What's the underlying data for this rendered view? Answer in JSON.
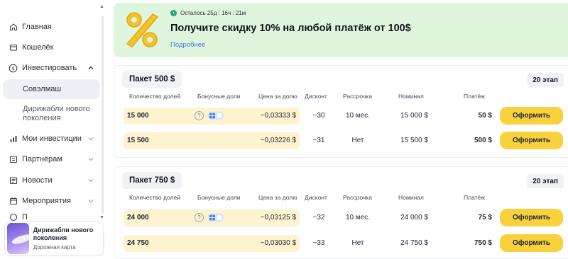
{
  "sidebar": {
    "items": [
      {
        "label": "Главная",
        "icon": "home-icon"
      },
      {
        "label": "Кошелёк",
        "icon": "wallet-icon"
      },
      {
        "label": "Инвестировать",
        "icon": "coin-icon",
        "expanded": true
      },
      {
        "label": "Мои инвестиции",
        "icon": "chart-icon"
      },
      {
        "label": "Партнёрам",
        "icon": "partners-icon"
      },
      {
        "label": "Новости",
        "icon": "news-icon"
      },
      {
        "label": "Мероприятия",
        "icon": "calendar-icon"
      },
      {
        "label": "П",
        "icon": "partial-icon"
      }
    ],
    "subitems": {
      "active": "Совэлмаш",
      "other": "Дирижабли нового поколения"
    },
    "promo": {
      "title": "Дирижабли нового поколения",
      "subtitle": "Дорожная карта"
    }
  },
  "banner": {
    "timer": "Осталось 25д : 16ч : 21м",
    "title": "Получите скидку 10% на любой платёж от 100$",
    "link": "Подробнее",
    "accent": "#dff5de"
  },
  "table_headers": [
    "Количество долей",
    "Бонусные доли",
    "Цена за долю",
    "Дисконт",
    "Рассрочка",
    "Номинал",
    "Платёж"
  ],
  "packages": [
    {
      "title": "Пакет 500 $",
      "stage": "20 этап",
      "rows": [
        {
          "shares": "15 000",
          "bonus": true,
          "price": "~0,03333 $",
          "discount": "~30",
          "installment": "10 мес.",
          "nominal": "15 000 $",
          "payment": "50 $",
          "button": "Оформить"
        },
        {
          "shares": "15 500",
          "bonus": false,
          "price": "~0,03226 $",
          "discount": "~31",
          "installment": "Нет",
          "nominal": "15 500 $",
          "payment": "500 $",
          "button": "Оформить"
        }
      ]
    },
    {
      "title": "Пакет 750 $",
      "stage": "20 этап",
      "rows": [
        {
          "shares": "24 000",
          "bonus": true,
          "price": "~0,03125 $",
          "discount": "~32",
          "installment": "10 мес.",
          "nominal": "24 000 $",
          "payment": "75 $",
          "button": "Оформить"
        },
        {
          "shares": "24 750",
          "bonus": false,
          "price": "~0,03030 $",
          "discount": "~33",
          "installment": "Нет",
          "nominal": "24 750 $",
          "payment": "750 $",
          "button": "Оформить"
        }
      ]
    }
  ],
  "colors": {
    "button": "#f9d13d",
    "row_highlight": "#fdf3cf",
    "link": "#3a7fd5",
    "timer_dot": "#1ea672"
  }
}
